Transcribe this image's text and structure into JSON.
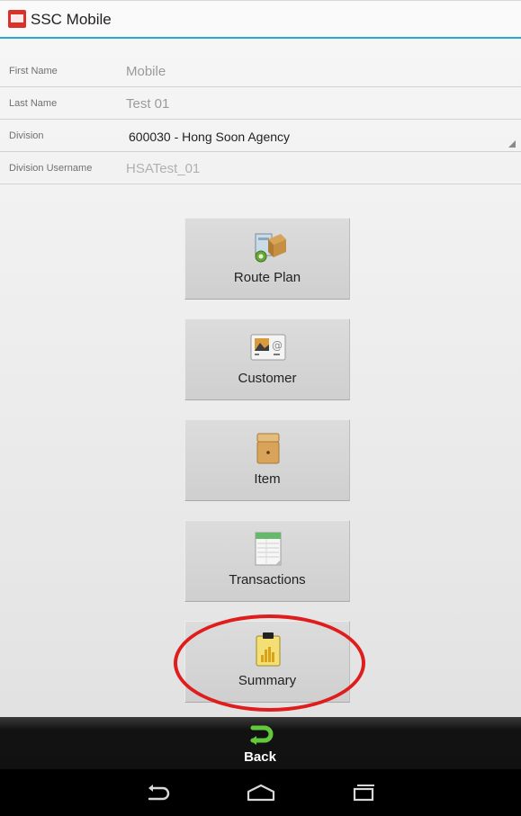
{
  "app": {
    "title": "SSC Mobile",
    "accent": "#2ea7d6",
    "highlight": "#e01d1d"
  },
  "form": {
    "first_name": {
      "label": "First Name",
      "value": "Mobile"
    },
    "last_name": {
      "label": "Last Name",
      "value": "Test 01"
    },
    "division": {
      "label": "Division",
      "value": "600030 - Hong Soon Agency"
    },
    "division_username": {
      "label": "Division Username",
      "value": "HSATest_01"
    }
  },
  "menu": {
    "route_plan": "Route Plan",
    "customer": "Customer",
    "item": "Item",
    "transactions": "Transactions",
    "summary": "Summary"
  },
  "bottom_bar": {
    "back_label": "Back"
  },
  "nav_icons": [
    "back-arrow-icon",
    "home-icon",
    "recent-apps-icon"
  ]
}
